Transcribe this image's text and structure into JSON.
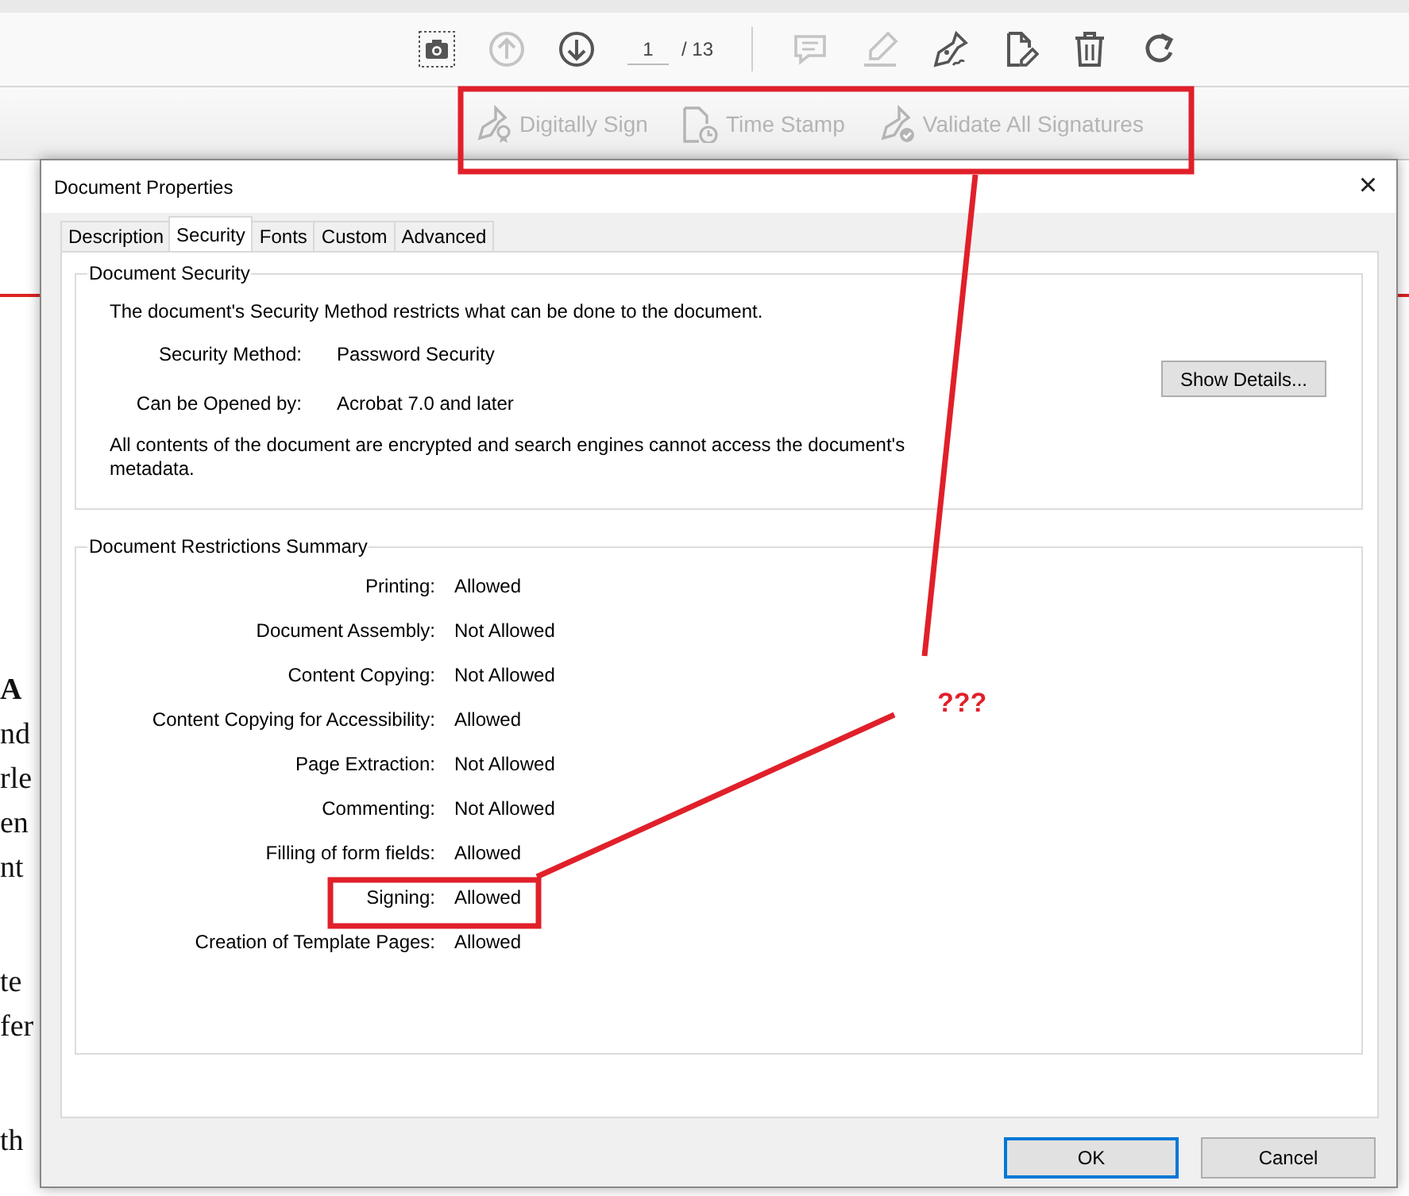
{
  "toolbar": {
    "tools": [
      {
        "kind": "camera",
        "disabled": false
      },
      {
        "kind": "prev",
        "disabled": true
      },
      {
        "kind": "next",
        "disabled": false
      },
      {
        "kind": "page"
      },
      {
        "kind": "separator"
      },
      {
        "kind": "comment",
        "disabled": true
      },
      {
        "kind": "highlight",
        "disabled": true
      },
      {
        "kind": "sign",
        "disabled": false
      },
      {
        "kind": "edit",
        "disabled": false
      },
      {
        "kind": "trash",
        "disabled": false
      },
      {
        "kind": "rotate",
        "disabled": false
      }
    ],
    "page_current": "1",
    "page_total": "/ 13"
  },
  "signature_bar": [
    {
      "kind": "sign",
      "label": "Digitally Sign",
      "disabled": true
    },
    {
      "kind": "timestamp",
      "label": "Time Stamp",
      "disabled": true
    },
    {
      "kind": "validate",
      "label": "Validate All Signatures",
      "disabled": true
    }
  ],
  "document": {
    "left": [
      [
        {
          "text": "A",
          "bold": true
        },
        {
          "text": "nd",
          "bold": false
        },
        {
          "text": "rle",
          "bold": false
        },
        {
          "text": "en",
          "bold": false
        },
        {
          "text": "nt",
          "bold": false
        }
      ],
      [
        {
          "text": "te",
          "bold": false
        },
        {
          "text": "fer",
          "bold": false
        }
      ],
      [
        {
          "text": "th",
          "bold": false
        }
      ]
    ]
  },
  "dialog": {
    "title": "Document Properties",
    "close": "×",
    "tabs": [
      {
        "label": "Description",
        "selected": false
      },
      {
        "label": "Security",
        "selected": true
      },
      {
        "label": "Fonts",
        "selected": false
      },
      {
        "label": "Custom",
        "selected": false
      },
      {
        "label": "Advanced",
        "selected": false
      }
    ],
    "security": {
      "heading": "Document Security",
      "intro": "The document's Security Method restricts what can be done to the document.",
      "fields": [
        {
          "label": "Security Method:",
          "value": "Password Security"
        },
        {
          "label": "Can be Opened by:",
          "value": "Acrobat 7.0 and later"
        }
      ],
      "details_button": "Show Details...",
      "note": "All contents of the document are encrypted and search engines cannot access the document's metadata."
    },
    "restrictions": {
      "heading": "Document Restrictions Summary",
      "rows": [
        {
          "label": "Printing:",
          "value": "Allowed"
        },
        {
          "label": "Document Assembly:",
          "value": "Not Allowed"
        },
        {
          "label": "Content Copying:",
          "value": "Not Allowed"
        },
        {
          "label": "Content Copying for Accessibility:",
          "value": "Allowed"
        },
        {
          "label": "Page Extraction:",
          "value": "Not Allowed"
        },
        {
          "label": "Commenting:",
          "value": "Not Allowed"
        },
        {
          "label": "Filling of form fields:",
          "value": "Allowed"
        },
        {
          "label": "Signing:",
          "value": "Allowed"
        },
        {
          "label": "Creation of Template Pages:",
          "value": "Allowed"
        }
      ]
    },
    "buttons": [
      {
        "label": "OK",
        "default": true
      },
      {
        "label": "Cancel",
        "default": false
      }
    ]
  },
  "annotation": {
    "text": "???"
  }
}
